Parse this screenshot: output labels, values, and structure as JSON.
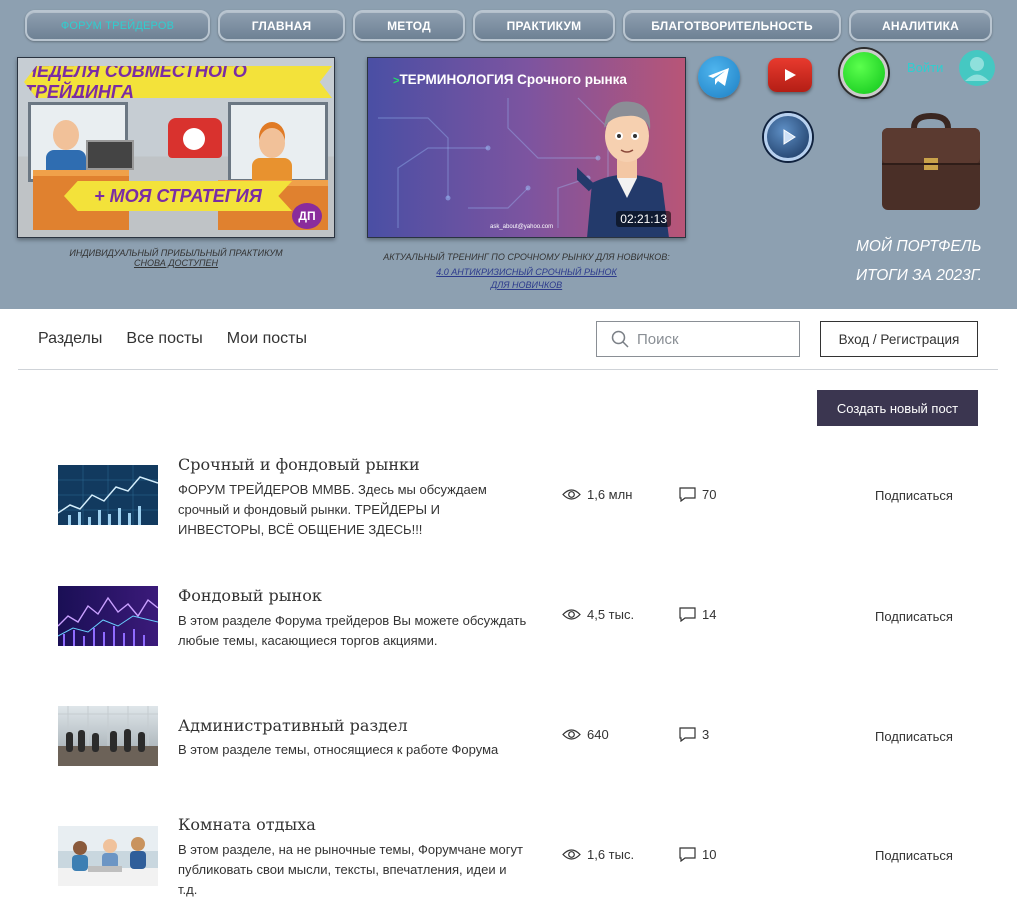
{
  "nav": [
    {
      "label": "ФОРУМ ТРЕЙДЕРОВ"
    },
    {
      "label": "ГЛАВНАЯ"
    },
    {
      "label": "МЕТОД"
    },
    {
      "label": "ПРАКТИКУМ"
    },
    {
      "label": "БЛАГОТВОРИТЕЛЬНОСТЬ"
    },
    {
      "label": "АНАЛИТИКА"
    }
  ],
  "promo1": {
    "banner_top": "НЕДЕЛЯ СОВМЕСТНОГО ТРЕЙДИНГА",
    "banner_bottom": "+ МОЯ СТРАТЕГИЯ",
    "badge": "ДП",
    "caption_line1": "ИНДИВИДУАЛЬНЫЙ ПРИБЫЛЬНЫЙ ПРАКТИКУМ",
    "caption_line2": "СНОВА ДОСТУПЕН"
  },
  "promo2": {
    "title_arrow": ">",
    "title": "ТЕРМИНОЛОГИЯ Срочного рынка",
    "email": "ask_about@yahoo.com",
    "duration": "02:21:13",
    "caption_line1": "АКТУАЛЬНЫЙ  ТРЕНИНГ ПО СРОЧНОМУ РЫНКУ ДЛЯ НОВИЧКОВ:",
    "caption_link1": "4.0 АНТИКРИЗИСНЫЙ СРОЧНЫЙ РЫНОК",
    "caption_link2": "ДЛЯ НОВИЧКОВ"
  },
  "header_right": {
    "login": "Войти",
    "portfolio_line1": "МОЙ ПОРТФЕЛЬ",
    "portfolio_line2": "ИТОГИ ЗА 2023г."
  },
  "forum": {
    "tabs": [
      "Разделы",
      "Все посты",
      "Мои посты"
    ],
    "search_placeholder": "Поиск",
    "login_button": "Вход / Регистрация",
    "create_button": "Создать новый пост",
    "subscribe_label": "Подписаться",
    "categories": [
      {
        "title": "Срочный и фондовый рынки",
        "description": "ФОРУМ ТРЕЙДЕРОВ ММВБ. Здесь мы обсуждаем срочный и фондовый рынки. ТРЕЙДЕРЫ И ИНВЕСТОРЫ, ВСЁ ОБЩЕНИЕ ЗДЕСЬ!!!",
        "views": "1,6 млн",
        "comments": "70"
      },
      {
        "title": "Фондовый рынок",
        "description": "В этом разделе Форума трейдеров Вы можете обсуждать любые темы, касающиеся торгов акциями.",
        "views": "4,5 тыс.",
        "comments": "14"
      },
      {
        "title": "Административный раздел",
        "description": "В этом разделе темы, относящиеся к работе Форума",
        "views": "640",
        "comments": "3"
      },
      {
        "title": "Комната отдыха",
        "description": "В этом разделе, на не рыночные темы, Форумчане могут публиковать свои мысли, тексты, впечатления, идеи и т.д.",
        "views": "1,6 тыс.",
        "comments": "10"
      }
    ]
  },
  "colors": {
    "header_bg": "#8da0b1",
    "nav_active": "#2ecfd0",
    "create_button_bg": "#3b3650"
  }
}
